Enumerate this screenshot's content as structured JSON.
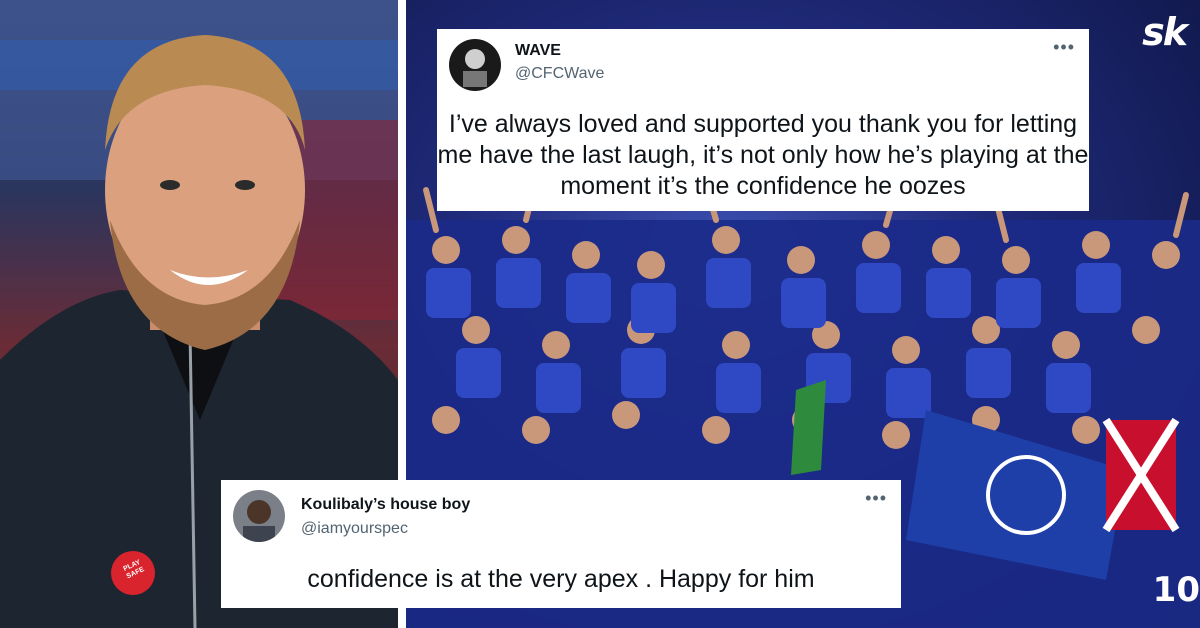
{
  "branding": {
    "logo_text": "sk"
  },
  "left_photo": {
    "pin_text": "PLAY SAFE"
  },
  "crowd_photo": {
    "jersey_number": "10"
  },
  "tweets": [
    {
      "name": "WAVE",
      "handle": "@CFCWave",
      "text": "I’ve always loved and supported you thank you for letting me have the last laugh, it’s not only how he’s playing at the moment it’s the confidence he oozes",
      "more_icon": "more-horizontal-icon"
    },
    {
      "name": "Koulibaly’s house boy",
      "handle": "@iamyourspec",
      "text": "confidence is at the very apex . Happy for him",
      "more_icon": "more-horizontal-icon"
    }
  ],
  "colors": {
    "chelsea_blue": "#1f3fa8",
    "tweet_bg": "#ffffff",
    "handle_gray": "#536471"
  }
}
